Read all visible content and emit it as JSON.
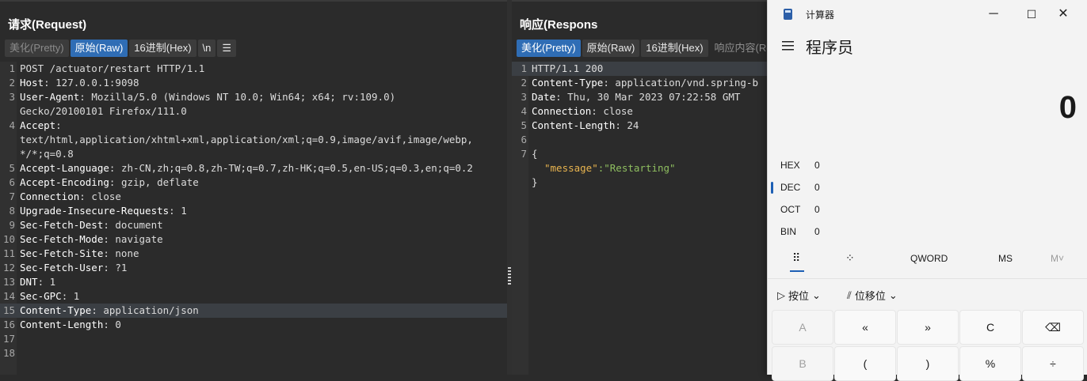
{
  "request": {
    "title": "请求(Request)",
    "tabs": [
      "美化(Pretty)",
      "原始(Raw)",
      "16进制(Hex)",
      "\\n",
      "☰"
    ],
    "lines": [
      {
        "n": "1",
        "key": "",
        "val": "POST /actuator/restart HTTP/1.1"
      },
      {
        "n": "2",
        "key": "Host",
        "val": ": 127.0.0.1:9098"
      },
      {
        "n": "3",
        "key": "User-Agent",
        "val": ": Mozilla/5.0 (Windows NT 10.0; Win64; x64; rv:109.0)"
      },
      {
        "n": "",
        "key": "",
        "val": "Gecko/20100101 Firefox/111.0"
      },
      {
        "n": "4",
        "key": "Accept",
        "val": ":"
      },
      {
        "n": "",
        "key": "",
        "val": "text/html,application/xhtml+xml,application/xml;q=0.9,image/avif,image/webp,"
      },
      {
        "n": "",
        "key": "",
        "val": "*/*;q=0.8"
      },
      {
        "n": "5",
        "key": "Accept-Language",
        "val": ": zh-CN,zh;q=0.8,zh-TW;q=0.7,zh-HK;q=0.5,en-US;q=0.3,en;q=0.2"
      },
      {
        "n": "6",
        "key": "Accept-Encoding",
        "val": ": gzip, deflate"
      },
      {
        "n": "7",
        "key": "Connection",
        "val": ": close"
      },
      {
        "n": "8",
        "key": "Upgrade-Insecure-Requests",
        "val": ": 1"
      },
      {
        "n": "9",
        "key": "Sec-Fetch-Dest",
        "val": ": document"
      },
      {
        "n": "10",
        "key": "Sec-Fetch-Mode",
        "val": ": navigate"
      },
      {
        "n": "11",
        "key": "Sec-Fetch-Site",
        "val": ": none"
      },
      {
        "n": "12",
        "key": "Sec-Fetch-User",
        "val": ": ?1"
      },
      {
        "n": "13",
        "key": "DNT",
        "val": ": 1"
      },
      {
        "n": "14",
        "key": "Sec-GPC",
        "val": ": 1"
      },
      {
        "n": "15",
        "key": "Content-Type",
        "val": ": application/json"
      },
      {
        "n": "16",
        "key": "Content-Length",
        "val": ": 0"
      },
      {
        "n": "17",
        "key": "",
        "val": ""
      },
      {
        "n": "18",
        "key": "",
        "val": ""
      }
    ]
  },
  "response": {
    "title": "响应(Respons",
    "tabs": [
      "美化(Pretty)",
      "原始(Raw)",
      "16进制(Hex)",
      "响应内容(Re"
    ],
    "lines": [
      {
        "n": "1",
        "key": "",
        "val": "HTTP/1.1 200"
      },
      {
        "n": "2",
        "key": "Content-Type",
        "val": ": application/vnd.spring-b"
      },
      {
        "n": "3",
        "key": "Date",
        "val": ": Thu, 30 Mar 2023 07:22:58 GMT"
      },
      {
        "n": "4",
        "key": "Connection",
        "val": ": close"
      },
      {
        "n": "5",
        "key": "Content-Length",
        "val": ": 24"
      },
      {
        "n": "6",
        "key": "",
        "val": ""
      },
      {
        "n": "7",
        "key": "",
        "val": "{"
      },
      {
        "n": "",
        "key": "\"message\"",
        "val": ":\"Restarting\""
      },
      {
        "n": "",
        "key": "",
        "val": "}"
      }
    ]
  },
  "calculator": {
    "title": "计算器",
    "mode": "程序员",
    "display": "0",
    "bases": [
      {
        "name": "HEX",
        "value": "0"
      },
      {
        "name": "DEC",
        "value": "0"
      },
      {
        "name": "OCT",
        "value": "0"
      },
      {
        "name": "BIN",
        "value": "0"
      }
    ],
    "word": "QWORD",
    "ms": "MS",
    "mv": "M˅",
    "bitwise": "按位",
    "bitshift": "位移位",
    "keys_row1": [
      "A",
      "«",
      "»",
      "C",
      "⌫"
    ],
    "keys_row2": [
      "B",
      "(",
      ")",
      "%",
      "÷"
    ]
  },
  "colors": {
    "accent": "#2f6db5",
    "key": "#ffffff",
    "string": "#8fbf60"
  }
}
